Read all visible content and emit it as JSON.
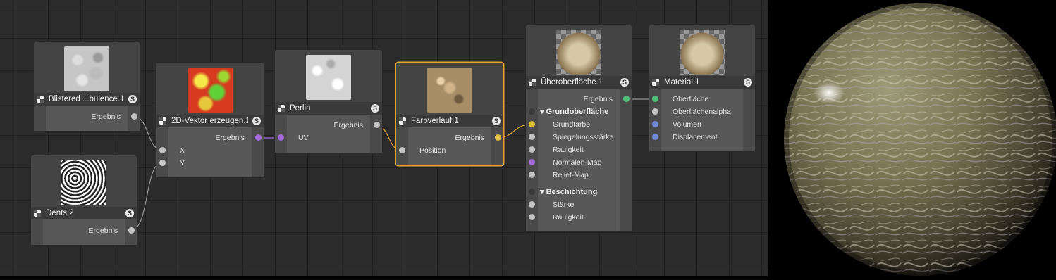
{
  "nodes": {
    "blistered": {
      "title": "Blistered ...bulence.1",
      "badge": "S",
      "output": "Ergebnis"
    },
    "dents": {
      "title": "Dents.2",
      "badge": "S",
      "output": "Ergebnis"
    },
    "vector2d": {
      "title": "2D-Vektor erzeugen.1",
      "badge": "S",
      "output": "Ergebnis",
      "inputs": [
        "X",
        "Y"
      ]
    },
    "perlin": {
      "title": "Perlin",
      "badge": "S",
      "output": "Ergebnis",
      "inputs": [
        "UV"
      ]
    },
    "farbverlauf": {
      "title": "Farbverlauf.1",
      "badge": "S",
      "output": "Ergebnis",
      "inputs": [
        "Position"
      ]
    },
    "ueber": {
      "title": "Überoberfläche.1",
      "badge": "S",
      "output": "Ergebnis",
      "group1": "Grundoberfläche",
      "group1_inputs": [
        "Grundfarbe",
        "Spiegelungsstärke",
        "Rauigkeit",
        "Normalen-Map",
        "Relief-Map"
      ],
      "group2": "Beschichtung",
      "group2_inputs": [
        "Stärke",
        "Rauigkeit"
      ]
    },
    "material": {
      "title": "Material.1",
      "badge": "S",
      "inputs": [
        "Oberfläche",
        "Oberflächenalpha",
        "Volumen",
        "Displacement"
      ]
    }
  },
  "colors": {
    "selected": "#e0a43a",
    "vector_port": "#a46cd8",
    "color_port": "#e2c13c",
    "material_port": "#4ec07a",
    "alpha_port": "#6f86d6"
  },
  "icons": {
    "node_icon": "checker-icon",
    "shader_badge": "s-badge-icon",
    "group_arrow": "triangle-down-icon"
  }
}
